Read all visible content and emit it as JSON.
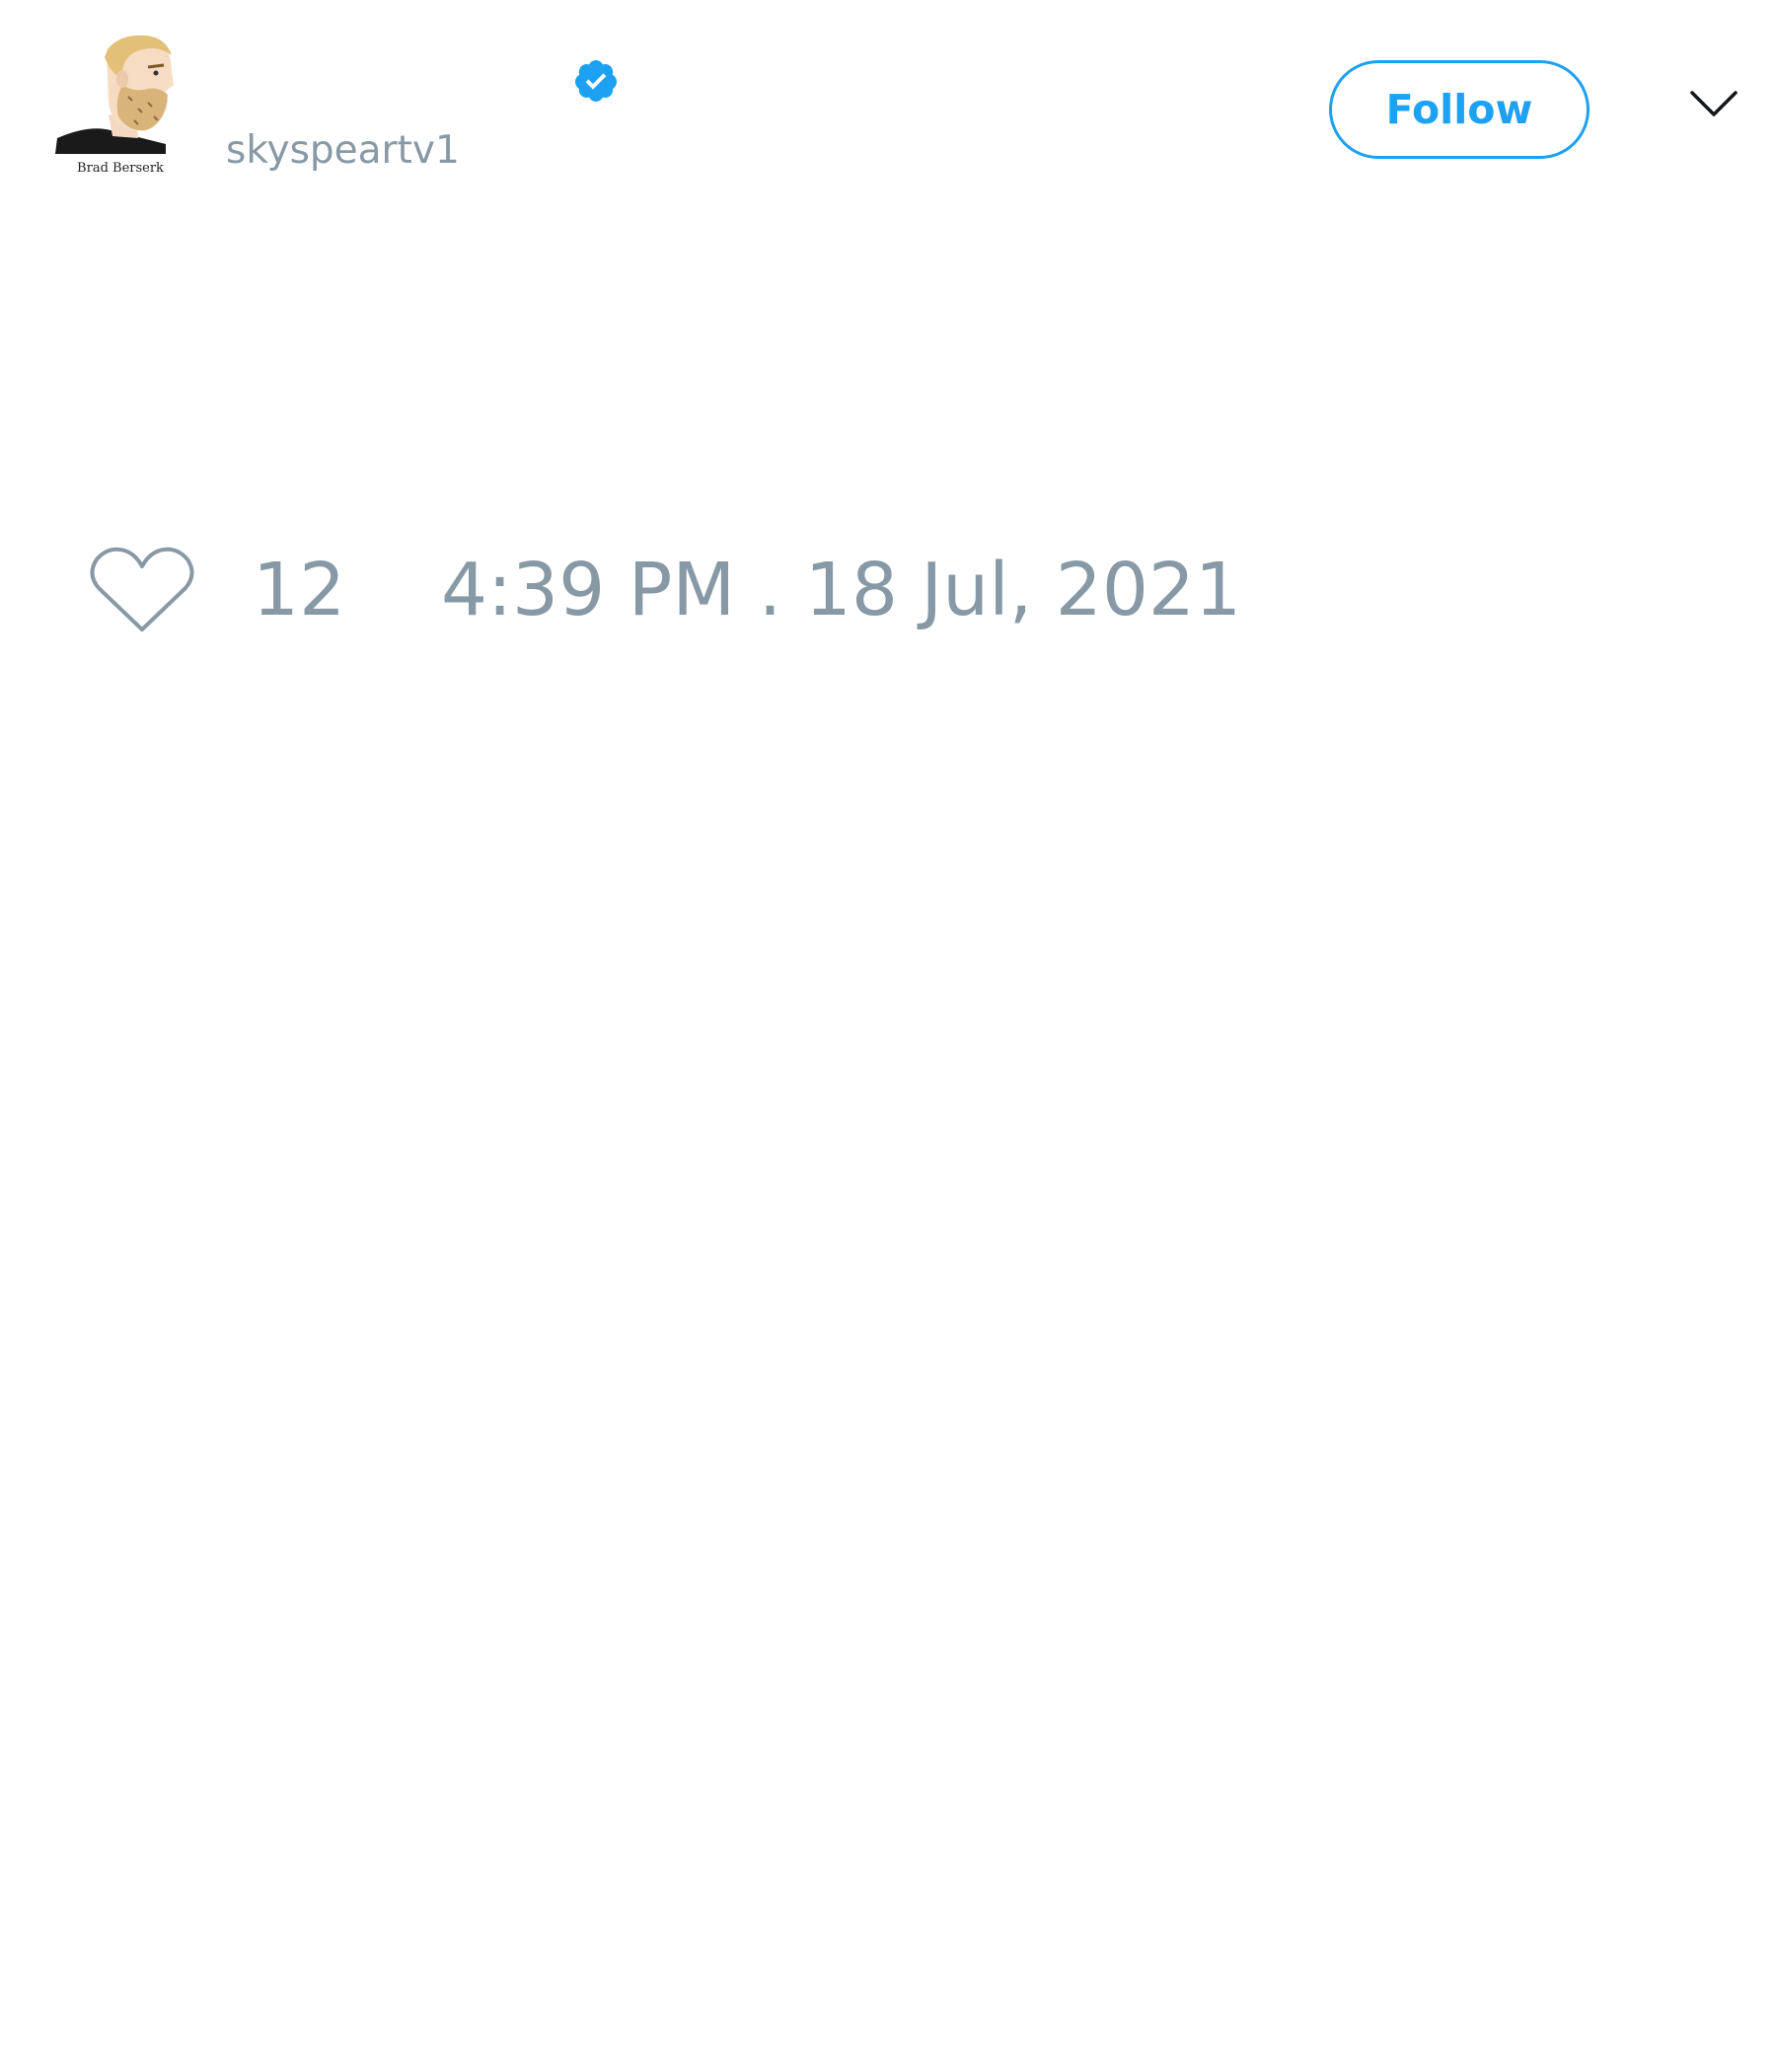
{
  "author": {
    "display_name": "",
    "username": "skyspeartv1",
    "verified": true,
    "avatar_caption": "Brad Berserk"
  },
  "header": {
    "follow_label": "Follow",
    "more_icon": "chevron-down-icon"
  },
  "tweet": {
    "text": "",
    "like_count": "12",
    "timestamp": "4:39 PM . 18 Jul, 2021"
  },
  "colors": {
    "accent": "#1da1f2",
    "muted": "#8899a6",
    "text": "#14171a",
    "background": "#ffffff"
  },
  "icons": {
    "verified": "verified-badge-icon",
    "like": "heart-icon"
  }
}
